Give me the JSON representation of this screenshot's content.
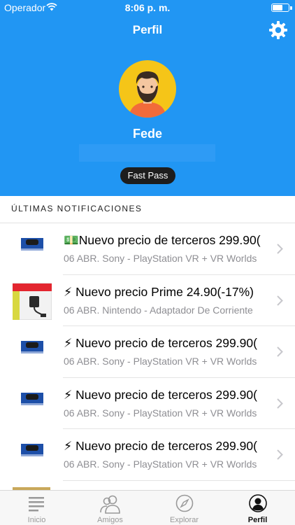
{
  "status_bar": {
    "carrier": "Operador",
    "time": "8:06 p. m."
  },
  "header": {
    "title": "Perfil",
    "username": "Fede",
    "badge": "Fast Pass"
  },
  "section": {
    "title": "ÚLTIMAS NOTIFICACIONES"
  },
  "notifications": [
    {
      "icon": "💵",
      "title": "Nuevo precio de terceros 299.90(",
      "subtitle": "06 ABR. Sony - PlayStation VR + VR Worlds",
      "thumb": "psvr-box-icon"
    },
    {
      "icon": "⚡",
      "title": "Nuevo precio Prime 24.90(-17%)",
      "subtitle": "06 ABR. Nintendo - Adaptador De Corriente",
      "thumb": "nintendo-adapter-box-icon"
    },
    {
      "icon": "⚡",
      "title": "Nuevo precio de terceros 299.90(",
      "subtitle": "06 ABR. Sony - PlayStation VR + VR Worlds",
      "thumb": "psvr-box-icon"
    },
    {
      "icon": "⚡",
      "title": "Nuevo precio de terceros 299.90(",
      "subtitle": "06 ABR. Sony - PlayStation VR + VR Worlds",
      "thumb": "psvr-box-icon"
    },
    {
      "icon": "⚡",
      "title": "Nuevo precio de terceros 299.90(",
      "subtitle": "06 ABR. Sony - PlayStation VR + VR Worlds",
      "thumb": "psvr-box-icon"
    }
  ],
  "tabs": [
    {
      "label": "Inicio",
      "icon": "list-icon",
      "active": false
    },
    {
      "label": "Amigos",
      "icon": "friends-icon",
      "active": false
    },
    {
      "label": "Explorar",
      "icon": "compass-icon",
      "active": false
    },
    {
      "label": "Perfil",
      "icon": "profile-icon",
      "active": true
    }
  ],
  "colors": {
    "header_bg": "#2196F3",
    "avatar_bg": "#F5C518",
    "badge_bg": "#1d1d1d"
  }
}
